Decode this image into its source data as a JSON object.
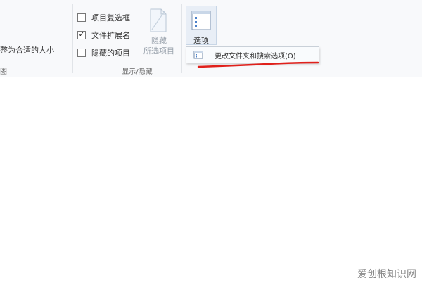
{
  "ribbon": {
    "partial_label": "整为合适的大小",
    "partial_group": "图",
    "checkboxes": [
      {
        "label": "项目复选框",
        "checked": false
      },
      {
        "label": "文件扩展名",
        "checked": true
      },
      {
        "label": "隐藏的项目",
        "checked": false
      }
    ],
    "hide_selected_label": "隐藏\n所选项目",
    "group_label": "显示/隐藏",
    "options_label": "选项",
    "dropdown_item": "更改文件夹和搜索选项(O)"
  },
  "checkmark": "✓",
  "colors": {
    "underline": "#e0201b",
    "accent": "#4a80c9"
  },
  "watermark": "爱创根知识网"
}
